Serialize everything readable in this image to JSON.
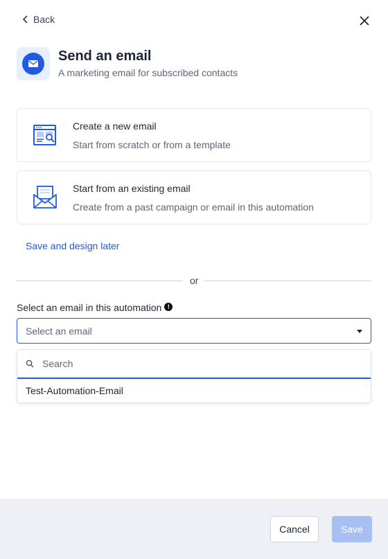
{
  "nav": {
    "back_label": "Back"
  },
  "header": {
    "title": "Send an email",
    "subtitle": "A marketing email for subscribed contacts",
    "icon": "envelope-icon"
  },
  "options": [
    {
      "title": "Create a new email",
      "description": "Start from scratch or from a template",
      "icon": "new-email-template-icon"
    },
    {
      "title": "Start from an existing email",
      "description": "Create from a past campaign or email in this automation",
      "icon": "existing-email-icon"
    }
  ],
  "save_later_label": "Save and design later",
  "divider_text": "or",
  "select": {
    "label": "Select an email in this automation",
    "placeholder": "Select an email",
    "search_placeholder": "Search",
    "results": [
      "Test-Automation-Email"
    ]
  },
  "footer": {
    "cancel_label": "Cancel",
    "save_label": "Save"
  },
  "colors": {
    "accent": "#1f5ae0",
    "save_disabled": "#a8bff4",
    "footer_bg": "#eef0f6"
  }
}
